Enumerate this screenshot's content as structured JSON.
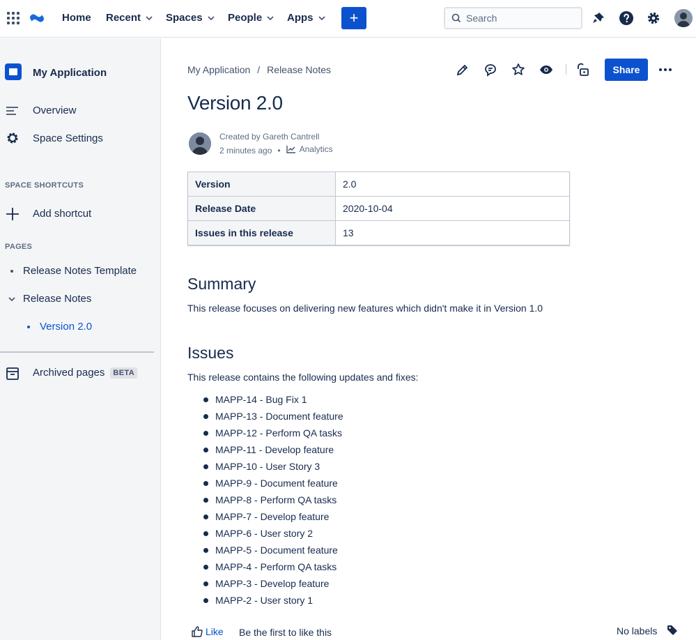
{
  "topnav": {
    "items": [
      {
        "label": "Home",
        "dropdown": false
      },
      {
        "label": "Recent",
        "dropdown": true
      },
      {
        "label": "Spaces",
        "dropdown": true
      },
      {
        "label": "People",
        "dropdown": true
      },
      {
        "label": "Apps",
        "dropdown": true
      }
    ],
    "create_label": "+",
    "search_placeholder": "Search"
  },
  "sidebar": {
    "space_name": "My Application",
    "items": [
      {
        "label": "Overview",
        "icon": "overview-icon"
      },
      {
        "label": "Space Settings",
        "icon": "gear-icon"
      }
    ],
    "shortcuts_heading": "SPACE SHORTCUTS",
    "add_shortcut": "Add shortcut",
    "pages_heading": "PAGES",
    "pages": [
      {
        "label": "Release Notes Template"
      },
      {
        "label": "Release Notes",
        "expanded": true
      },
      {
        "label": "Version 2.0",
        "selected": true
      }
    ],
    "archived_label": "Archived pages",
    "beta_badge": "BETA"
  },
  "main": {
    "breadcrumb": [
      "My Application",
      "Release Notes"
    ],
    "breadcrumb_sep": "/",
    "share_label": "Share",
    "title": "Version 2.0",
    "byline": {
      "created_by": "Created by Gareth Cantrell",
      "time": "2 minutes ago",
      "dot": "•",
      "analytics": "Analytics"
    },
    "info_table": [
      {
        "key": "Version",
        "value": "2.0"
      },
      {
        "key": "Release Date",
        "value": "2020-10-04"
      },
      {
        "key": "Issues in this release",
        "value": "13"
      }
    ],
    "summary_heading": "Summary",
    "summary_text": "This release focuses on delivering new features which didn't make it in Version 1.0",
    "issues_heading": "Issues",
    "issues_intro": "This release contains the following updates and fixes:",
    "issues": [
      "MAPP-14 - Bug Fix 1",
      "MAPP-13 - Document feature",
      "MAPP-12 - Perform QA tasks",
      "MAPP-11 - Develop feature",
      "MAPP-10 - User Story 3",
      "MAPP-9 - Document feature",
      "MAPP-8 - Perform QA tasks",
      "MAPP-7 - Develop feature",
      "MAPP-6 - User story 2",
      "MAPP-5 - Document feature",
      "MAPP-4 - Perform QA tasks",
      "MAPP-3 - Develop feature",
      "MAPP-2 - User story 1"
    ],
    "footer": {
      "like": "Like",
      "first_like": "Be the first to like this",
      "no_labels": "No labels"
    }
  },
  "colors": {
    "brand_blue": "#0c52cf",
    "text": "#172b4d",
    "muted": "#5e6c84",
    "sidebar_bg": "#f4f5f7"
  }
}
